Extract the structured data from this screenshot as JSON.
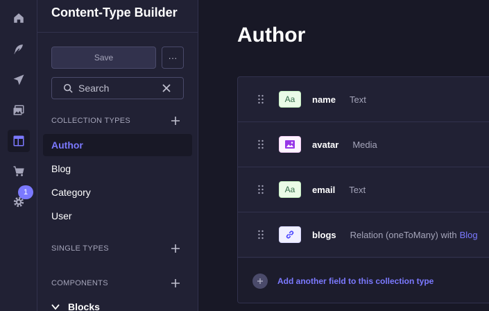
{
  "rail": {
    "icons": [
      "home-icon",
      "feather-icon",
      "paper-plane-icon",
      "media-library-icon",
      "layout-icon",
      "cart-icon",
      "gear-icon"
    ],
    "active": "layout-icon",
    "settings_badge": "1"
  },
  "subnav": {
    "title": "Content-Type Builder",
    "save_label": "Save",
    "more_label": "···",
    "search_placeholder": "Search",
    "sections": {
      "collection": "COLLECTION TYPES",
      "single": "SINGLE TYPES",
      "components": "COMPONENTS"
    },
    "collection_items": [
      "Author",
      "Blog",
      "Category",
      "User"
    ],
    "active_item": "Author",
    "blocks_label": "Blocks"
  },
  "main": {
    "title": "Author",
    "fields": [
      {
        "name": "name",
        "type": "Text",
        "icon": "text-type-icon"
      },
      {
        "name": "avatar",
        "type": "Media",
        "icon": "media-type-icon"
      },
      {
        "name": "email",
        "type": "Text",
        "icon": "text-type-icon"
      },
      {
        "name": "blogs",
        "type": "Relation (oneToMany) with",
        "link": "Blog",
        "icon": "relation-type-icon"
      }
    ],
    "add_field_label": "Add another field to this collection type",
    "text_chip": "Aa"
  },
  "colors": {
    "background": "#181826",
    "panel": "#212134",
    "accent": "#7b79ff",
    "muted": "#a5a5ba"
  }
}
